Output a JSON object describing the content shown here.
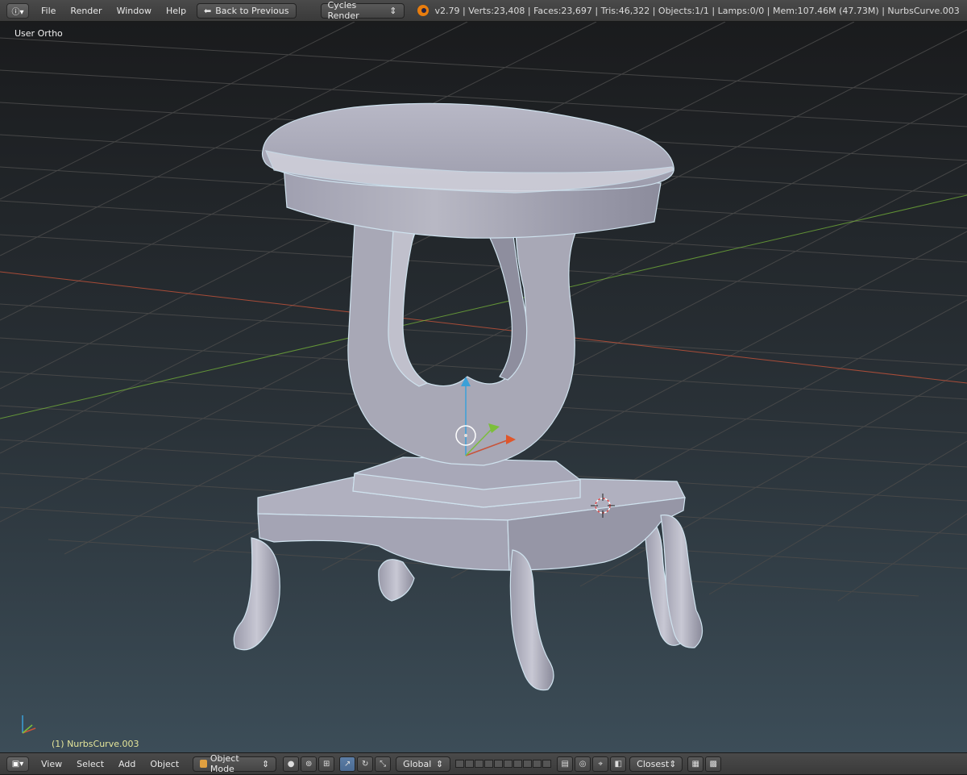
{
  "topbar": {
    "menus": [
      "File",
      "Render",
      "Window",
      "Help"
    ],
    "back_button": "Back to Previous",
    "render_engine": "Cycles Render",
    "stats": "v2.79 | Verts:23,408 | Faces:23,697 | Tris:46,322 | Objects:1/1 | Lamps:0/0 | Mem:107.46M (47.73M) | NurbsCurve.003"
  },
  "viewport": {
    "view_label": "User Ortho",
    "active_object_label": "(1) NurbsCurve.003"
  },
  "bottombar": {
    "menus": [
      "View",
      "Select",
      "Add",
      "Object"
    ],
    "mode": "Object Mode",
    "orientation": "Global",
    "snap_target": "Closest"
  },
  "colors": {
    "x_axis": "#c8543a",
    "y_axis": "#7cbf3a",
    "z_axis": "#3aa0d8",
    "object_label": "#e5e59a",
    "mesh": "#a8a8b8"
  }
}
